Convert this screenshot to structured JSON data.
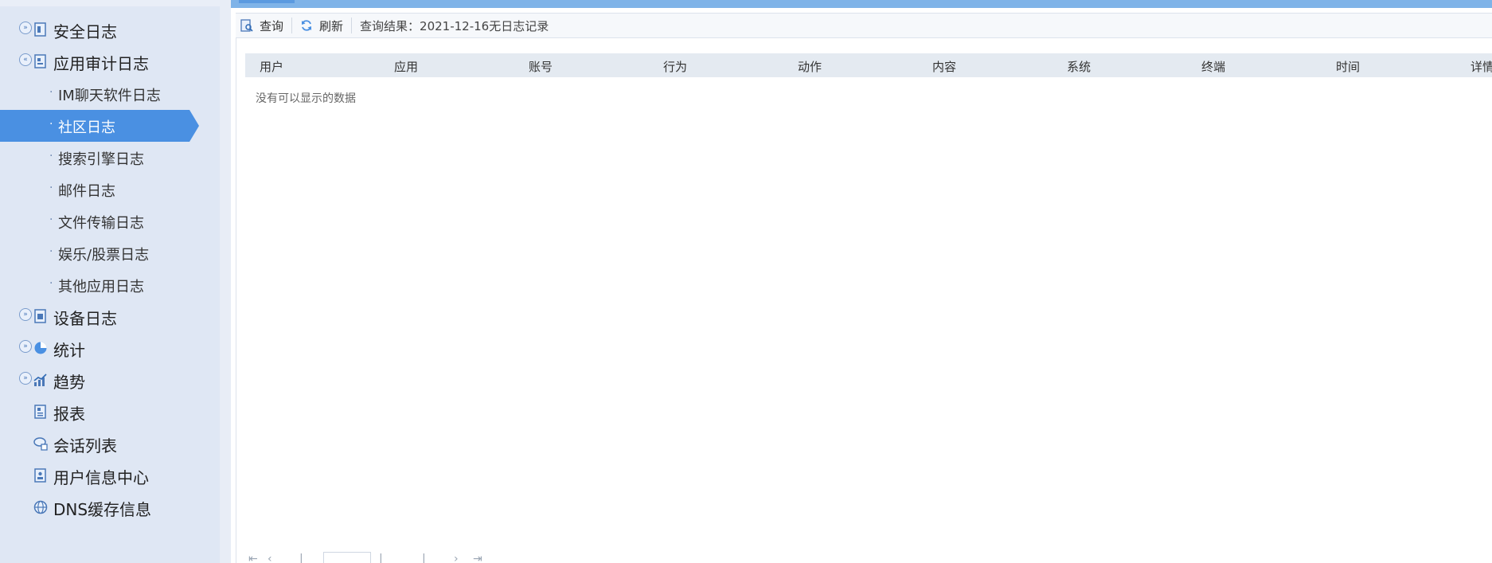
{
  "sidebar": {
    "items": [
      {
        "label": "安全日志",
        "icon": "document-icon",
        "toggle": "expand"
      },
      {
        "label": "应用审计日志",
        "icon": "document-icon",
        "toggle": "collapse",
        "children": [
          {
            "label": "IM聊天软件日志"
          },
          {
            "label": "社区日志",
            "active": true
          },
          {
            "label": "搜索引擎日志"
          },
          {
            "label": "邮件日志"
          },
          {
            "label": "文件传输日志"
          },
          {
            "label": "娱乐/股票日志"
          },
          {
            "label": "其他应用日志"
          }
        ]
      },
      {
        "label": "设备日志",
        "icon": "document-icon",
        "toggle": "expand"
      },
      {
        "label": "统计",
        "icon": "pie-chart-icon",
        "toggle": "expand"
      },
      {
        "label": "趋势",
        "icon": "trend-chart-icon",
        "toggle": "expand"
      },
      {
        "label": "报表",
        "icon": "report-icon"
      },
      {
        "label": "会话列表",
        "icon": "chat-icon"
      },
      {
        "label": "用户信息中心",
        "icon": "user-info-icon"
      },
      {
        "label": "DNS缓存信息",
        "icon": "globe-icon"
      }
    ]
  },
  "toolbar": {
    "query_label": "查询",
    "refresh_label": "刷新",
    "result_text": "查询结果：2021-12-16无日志记录"
  },
  "grid": {
    "columns": [
      "用户",
      "应用",
      "账号",
      "行为",
      "动作",
      "内容",
      "系统",
      "终端",
      "时间",
      "详情"
    ],
    "empty_text": "没有可以显示的数据"
  },
  "colors": {
    "accent": "#4a90e2",
    "sidebar_bg": "#dfe7f4",
    "header_bg": "#e4eaf1",
    "topbar": "#7fb3e8"
  }
}
